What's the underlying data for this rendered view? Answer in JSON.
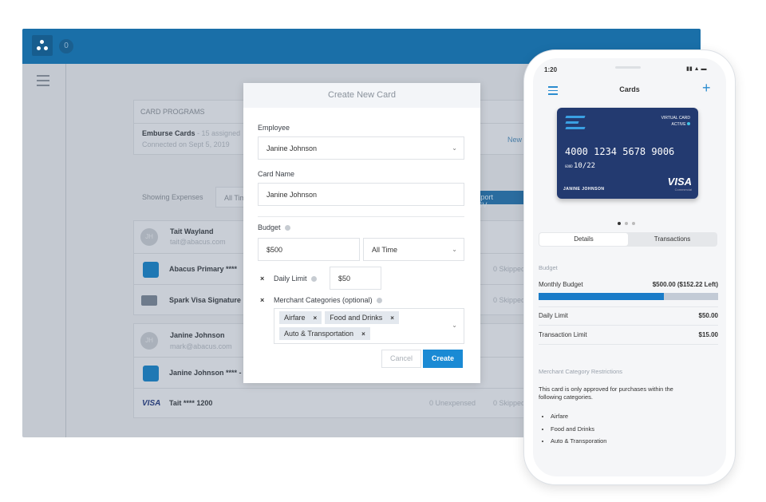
{
  "topbar": {
    "notification_count": "0"
  },
  "card_programs": {
    "header": "CARD PROGRAMS",
    "program_name": "Emburse Cards",
    "assigned": "- 15 assigned",
    "connected": "Connected on Sept 5, 2019",
    "new_link": "New"
  },
  "filters": {
    "label": "Showing Expenses",
    "period": "All Time",
    "export": "Export CSV"
  },
  "groups": [
    {
      "initials": "JH",
      "name": "Tait Wayland",
      "email": "tait@abacus.com",
      "cards": [
        {
          "icon": "emburse-icon",
          "name": "Abacus Primary ****",
          "skipped": "0 Skipped"
        },
        {
          "icon": "credit-card-icon",
          "name": "Spark Visa Signature",
          "skipped": "0 Skipped"
        }
      ]
    },
    {
      "initials": "JH",
      "name": "Janine Johnson",
      "email": "mark@abacus.com",
      "cards": [
        {
          "icon": "emburse-icon",
          "name": "Janine Johnson **** -",
          "skipped": ""
        },
        {
          "icon": "visa-icon",
          "name": "Tait **** 1200",
          "unexpensed": "0 Unexpensed",
          "skipped": "0 Skipped"
        }
      ]
    }
  ],
  "modal": {
    "title": "Create New Card",
    "employee_label": "Employee",
    "employee_value": "Janine Johnson",
    "card_name_label": "Card Name",
    "card_name_value": "Janine Johnson",
    "budget_label": "Budget",
    "budget_value": "$500",
    "budget_period": "All Time",
    "daily_limit_label": "Daily Limit",
    "daily_limit_value": "$50",
    "merchant_label": "Merchant Categories (optional)",
    "tags": [
      "Airfare",
      "Food and Drinks",
      "Auto & Transportation"
    ],
    "cancel": "Cancel",
    "create": "Create"
  },
  "phone": {
    "time": "1:20",
    "title": "Cards",
    "card": {
      "type": "VIRTUAL CARD",
      "status": "ACTIVE",
      "number": "4000 1234 5678 9006",
      "expiry": "10/22",
      "holder": "JANINE JOHNSON",
      "brand": "VISA",
      "brand_sub": "Commercial"
    },
    "tabs": [
      "Details",
      "Transactions"
    ],
    "budget_section": "Budget",
    "monthly_budget_label": "Monthly Budget",
    "monthly_budget_value": "$500.00 ($152.22 Left)",
    "budget_used_fraction": 0.6956,
    "daily_limit_label": "Daily Limit",
    "daily_limit_value": "$50.00",
    "transaction_limit_label": "Transaction Limit",
    "transaction_limit_value": "$15.00",
    "merchant_section": "Merchant Category Restrictions",
    "merchant_text": "This card is only approved for purchases within the following categories.",
    "categories": [
      "Airfare",
      "Food and Drinks",
      "Auto & Transporation"
    ]
  },
  "colors": {
    "brand_blue": "#1a6fa8",
    "primary_button": "#1a8ad4",
    "card_navy": "#233a70"
  }
}
